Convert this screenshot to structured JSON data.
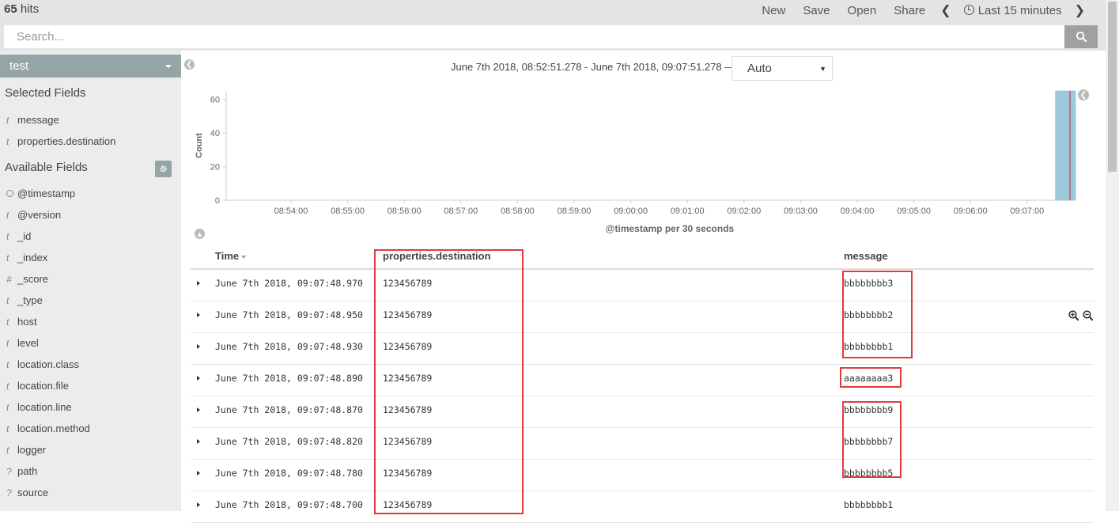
{
  "header": {
    "hits_count": "65",
    "hits_label": " hits",
    "nav": [
      "New",
      "Save",
      "Open",
      "Share"
    ],
    "time_range_label": "Last 15 minutes"
  },
  "search": {
    "placeholder": "Search..."
  },
  "sidebar": {
    "index_pattern": "test",
    "selected_title": "Selected Fields",
    "selected_fields": [
      {
        "type": "t",
        "name": "message"
      },
      {
        "type": "t",
        "name": "properties.destination"
      }
    ],
    "available_title": "Available Fields",
    "available_fields": [
      {
        "type": "clock",
        "name": "@timestamp"
      },
      {
        "type": "t",
        "name": "@version"
      },
      {
        "type": "t",
        "name": "_id"
      },
      {
        "type": "t",
        "name": "_index"
      },
      {
        "type": "#",
        "name": "_score"
      },
      {
        "type": "t",
        "name": "_type"
      },
      {
        "type": "t",
        "name": "host"
      },
      {
        "type": "t",
        "name": "level"
      },
      {
        "type": "t",
        "name": "location.class"
      },
      {
        "type": "t",
        "name": "location.file"
      },
      {
        "type": "t",
        "name": "location.line"
      },
      {
        "type": "t",
        "name": "location.method"
      },
      {
        "type": "t",
        "name": "logger"
      },
      {
        "type": "?",
        "name": "path"
      },
      {
        "type": "?",
        "name": "source"
      }
    ]
  },
  "main": {
    "range_text": "June 7th 2018, 08:52:51.278 - June 7th 2018, 09:07:51.278 —",
    "interval": "Auto"
  },
  "chart_data": {
    "type": "bar",
    "ylabel": "Count",
    "xlabel": "@timestamp per 30 seconds",
    "ylim": [
      0,
      65
    ],
    "y_ticks": [
      "0",
      "20",
      "40",
      "60"
    ],
    "x_ticks": [
      "08:54:00",
      "08:55:00",
      "08:56:00",
      "08:57:00",
      "08:58:00",
      "08:59:00",
      "09:00:00",
      "09:01:00",
      "09:02:00",
      "09:03:00",
      "09:04:00",
      "09:05:00",
      "09:06:00",
      "09:07:00"
    ],
    "bars": [
      {
        "x": "09:07:30",
        "value": 65
      }
    ],
    "bar_color": "#9ccada",
    "now_marker_color": "#c0546a"
  },
  "table": {
    "columns": [
      "Time",
      "properties.destination",
      "message"
    ],
    "rows": [
      {
        "time": "June 7th 2018, 09:07:48.970",
        "destination": "123456789",
        "message": "bbbbbbbb3"
      },
      {
        "time": "June 7th 2018, 09:07:48.950",
        "destination": "123456789",
        "message": "bbbbbbbb2"
      },
      {
        "time": "June 7th 2018, 09:07:48.930",
        "destination": "123456789",
        "message": "bbbbbbbb1"
      },
      {
        "time": "June 7th 2018, 09:07:48.890",
        "destination": "123456789",
        "message": "aaaaaaaa3"
      },
      {
        "time": "June 7th 2018, 09:07:48.870",
        "destination": "123456789",
        "message": "bbbbbbbb9"
      },
      {
        "time": "June 7th 2018, 09:07:48.820",
        "destination": "123456789",
        "message": "bbbbbbbb7"
      },
      {
        "time": "June 7th 2018, 09:07:48.780",
        "destination": "123456789",
        "message": "bbbbbbbb5"
      },
      {
        "time": "June 7th 2018, 09:07:48.700",
        "destination": "123456789",
        "message": "bbbbbbbb1"
      }
    ]
  },
  "colors": {
    "sidebar_accent": "#95a5a6",
    "highlight_box": "#e03c3c"
  }
}
